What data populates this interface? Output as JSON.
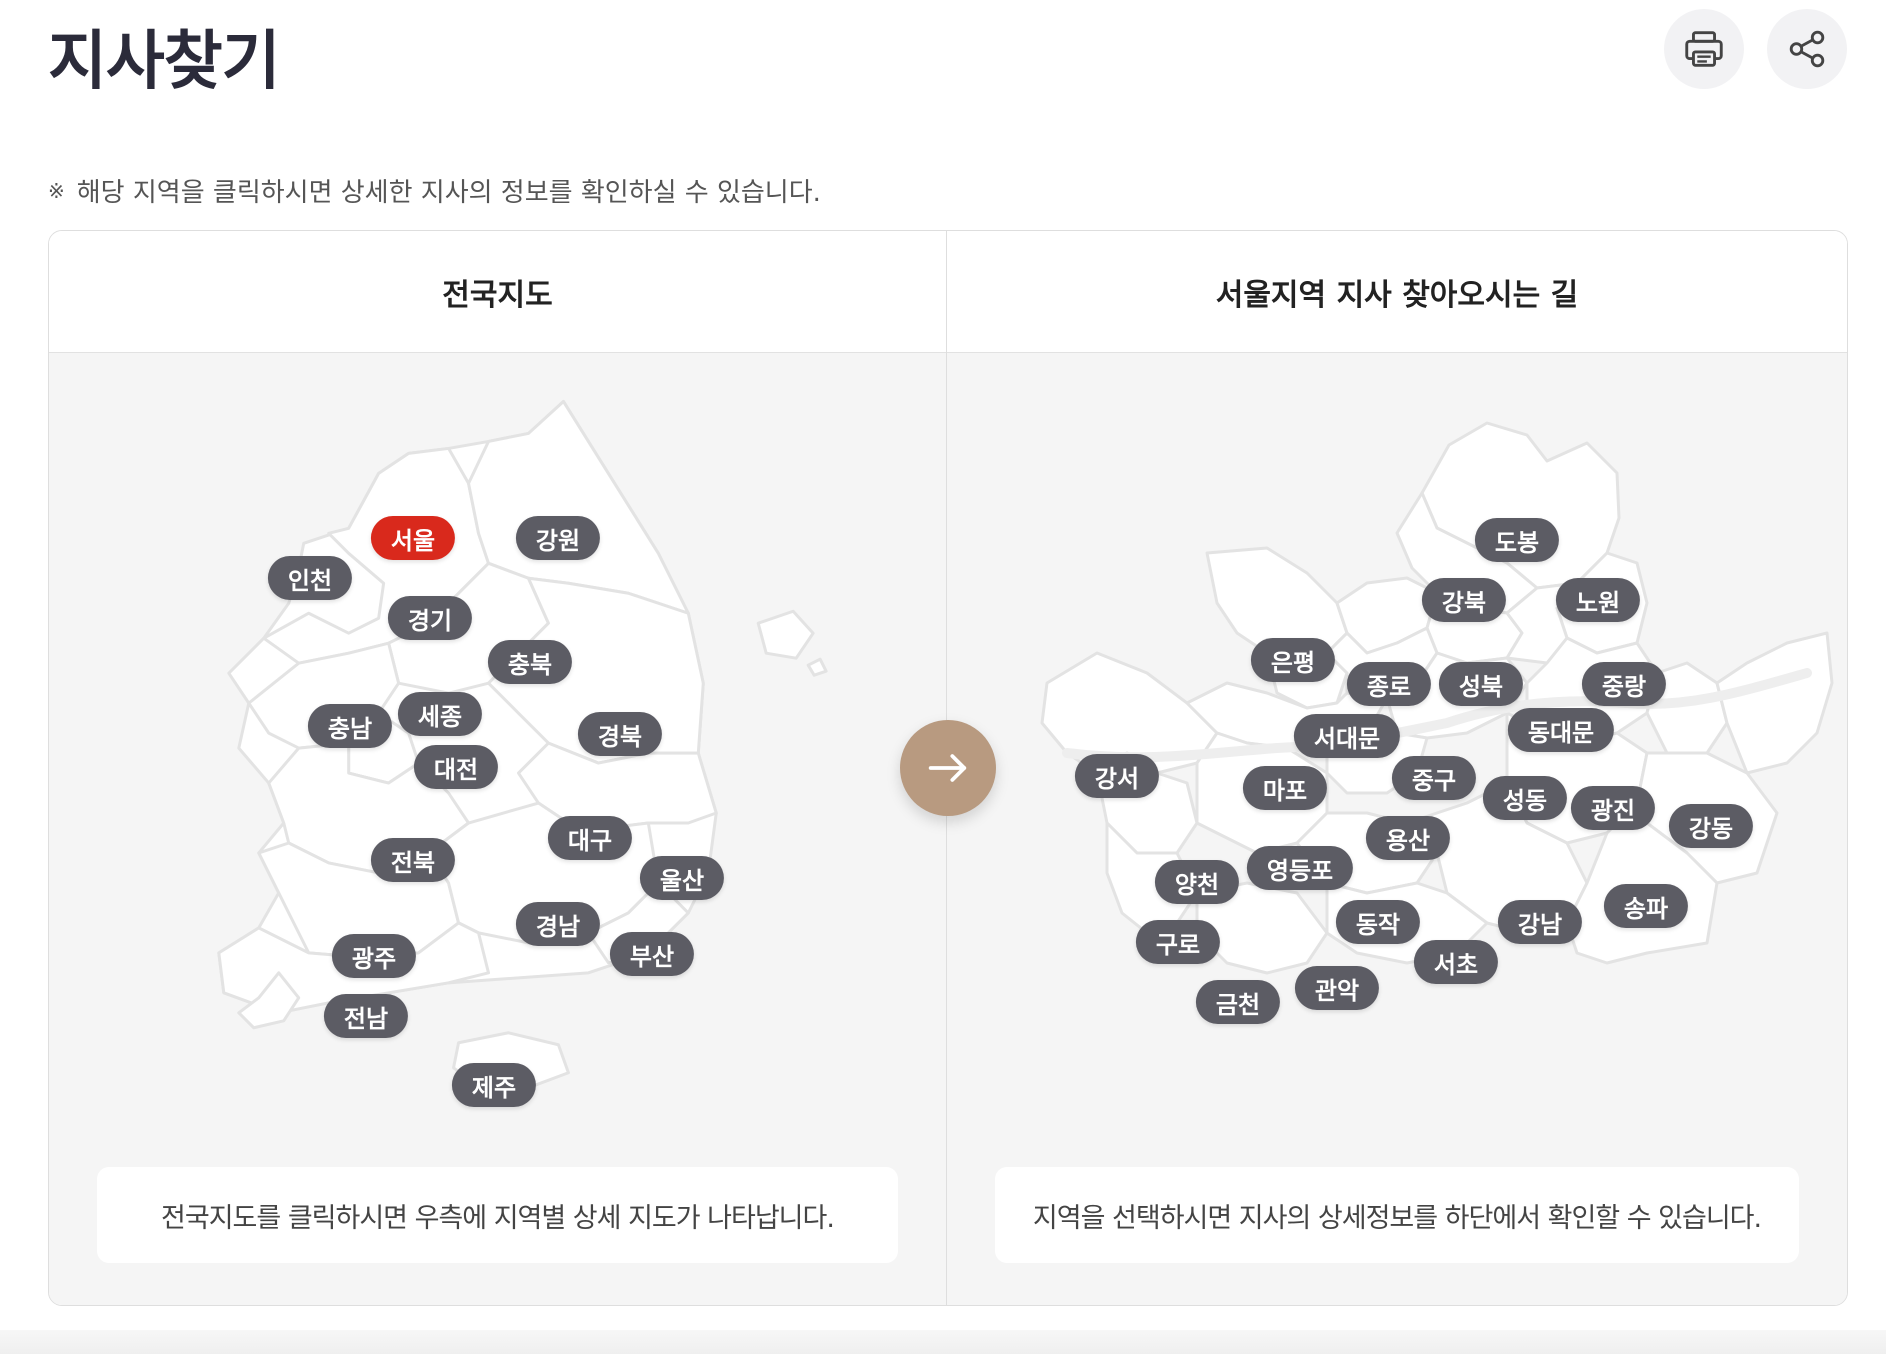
{
  "page": {
    "title": "지사찾기",
    "notice_mark": "※",
    "notice": "해당 지역을 클릭하시면 상세한 지사의 정보를 확인하실 수 있습니다."
  },
  "toolbar": {
    "print_icon": "printer-icon",
    "share_icon": "share-icon"
  },
  "left_panel": {
    "heading": "전국지도",
    "info": "전국지도를 클릭하시면 우측에 지역별 상세 지도가 나타납니다.",
    "active_region": "서울",
    "active_color": "#d9291c",
    "regions": [
      "서울",
      "강원",
      "인천",
      "경기",
      "충북",
      "충남",
      "세종",
      "경북",
      "대전",
      "대구",
      "전북",
      "울산",
      "경남",
      "광주",
      "부산",
      "전남",
      "제주"
    ]
  },
  "right_panel": {
    "heading": "서울지역 지사 찾아오시는 길",
    "info": "지역을 선택하시면 지사의 상세정보를 하단에서 확인할 수 있습니다.",
    "districts": [
      "도봉",
      "강북",
      "노원",
      "은평",
      "종로",
      "성북",
      "중랑",
      "서대문",
      "동대문",
      "강서",
      "마포",
      "중구",
      "성동",
      "광진",
      "강동",
      "용산",
      "양천",
      "영등포",
      "동작",
      "강남",
      "송파",
      "구로",
      "서초",
      "관악",
      "금천"
    ]
  },
  "arrow": {
    "icon": "arrow-right-icon",
    "color": "#b89a80"
  },
  "tag_color": "#5c5c64"
}
